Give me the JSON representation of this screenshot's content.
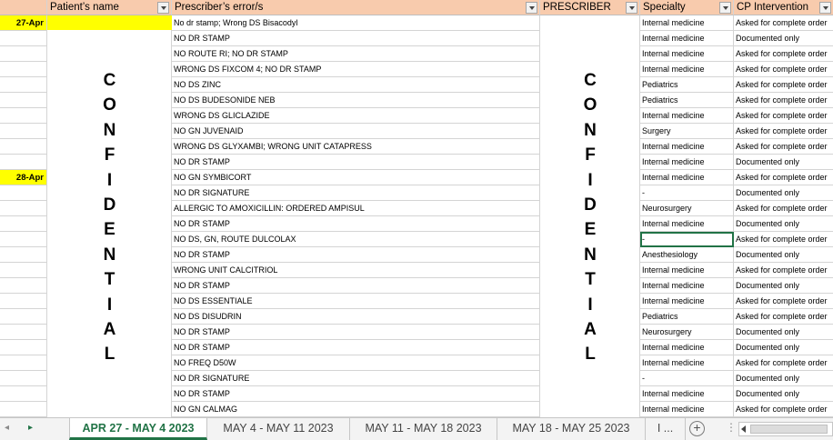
{
  "columns": {
    "patient": "Patient’s name",
    "error": "Prescriber’s error/s",
    "prescriber": "PRESCRIBER",
    "specialty": "Specialty",
    "intervention": "CP Intervention"
  },
  "confidential_letters": [
    "C",
    "O",
    "N",
    "F",
    "I",
    "D",
    "E",
    "N",
    "T",
    "I",
    "A",
    "L"
  ],
  "rows": [
    {
      "date": "27-Apr",
      "error": "No dr stamp; Wrong DS Bisacodyl",
      "specialty": "Internal medicine",
      "intervention": "Asked for complete order"
    },
    {
      "date": "",
      "error": "NO DR STAMP",
      "specialty": "Internal medicine",
      "intervention": "Documented only"
    },
    {
      "date": "",
      "error": "NO ROUTE RI; NO DR STAMP",
      "specialty": "Internal medicine",
      "intervention": "Asked for complete order"
    },
    {
      "date": "",
      "error": "WRONG DS FIXCOM 4; NO DR STAMP",
      "specialty": "Internal medicine",
      "intervention": "Asked for complete order"
    },
    {
      "date": "",
      "error": "NO DS ZINC",
      "specialty": "Pediatrics",
      "intervention": "Asked for complete order"
    },
    {
      "date": "",
      "error": "NO DS BUDESONIDE NEB",
      "specialty": "Pediatrics",
      "intervention": "Asked for complete order"
    },
    {
      "date": "",
      "error": "WRONG DS GLICLAZIDE",
      "specialty": "Internal medicine",
      "intervention": "Asked for complete order"
    },
    {
      "date": "",
      "error": "NO GN JUVENAID",
      "specialty": "Surgery",
      "intervention": "Asked for complete order"
    },
    {
      "date": "",
      "error": "WRONG DS GLYXAMBI; WRONG UNIT CATAPRESS",
      "specialty": "Internal medicine",
      "intervention": "Asked for complete order"
    },
    {
      "date": "",
      "error": "NO DR STAMP",
      "specialty": "Internal medicine",
      "intervention": "Documented only"
    },
    {
      "date": "28-Apr",
      "error": "NO GN SYMBICORT",
      "specialty": "Internal medicine",
      "intervention": "Asked for complete order"
    },
    {
      "date": "",
      "error": "NO DR SIGNATURE",
      "specialty": "-",
      "intervention": "Documented only"
    },
    {
      "date": "",
      "error": "ALLERGIC TO AMOXICILLIN: ORDERED AMPISUL",
      "specialty": "Neurosurgery",
      "intervention": "Asked for complete order"
    },
    {
      "date": "",
      "error": "NO DR STAMP",
      "specialty": "Internal medicine",
      "intervention": "Documented only"
    },
    {
      "date": "",
      "error": "NO DS, GN, ROUTE DULCOLAX",
      "specialty": "-",
      "intervention": "Asked for complete order"
    },
    {
      "date": "",
      "error": "NO DR STAMP",
      "specialty": "Anesthesiology",
      "intervention": "Documented only"
    },
    {
      "date": "",
      "error": "WRONG UNIT CALCITRIOL",
      "specialty": "Internal medicine",
      "intervention": "Asked for complete order"
    },
    {
      "date": "",
      "error": "NO DR STAMP",
      "specialty": "Internal medicine",
      "intervention": "Documented only"
    },
    {
      "date": "",
      "error": "NO DS ESSENTIALE",
      "specialty": "Internal medicine",
      "intervention": "Asked for complete order"
    },
    {
      "date": "",
      "error": "NO DS DISUDRIN",
      "specialty": "Pediatrics",
      "intervention": "Asked for complete order"
    },
    {
      "date": "",
      "error": "NO DR STAMP",
      "specialty": "Neurosurgery",
      "intervention": "Documented only"
    },
    {
      "date": "",
      "error": "NO DR STAMP",
      "specialty": "Internal medicine",
      "intervention": "Documented only"
    },
    {
      "date": "",
      "error": "NO FREQ D50W",
      "specialty": "Internal medicine",
      "intervention": "Asked for complete order"
    },
    {
      "date": "",
      "error": "NO DR SIGNATURE",
      "specialty": "-",
      "intervention": "Documented only"
    },
    {
      "date": "",
      "error": "NO DR STAMP",
      "specialty": "Internal medicine",
      "intervention": "Documented only"
    },
    {
      "date": "",
      "error": "NO GN CALMAG",
      "specialty": "Internal medicine",
      "intervention": "Asked for complete order"
    }
  ],
  "tabs": [
    {
      "label": "APR 27 - MAY 4 2023",
      "active": true
    },
    {
      "label": "MAY 4 - MAY 11 2023",
      "active": false
    },
    {
      "label": "MAY 11 - MAY 18 2023",
      "active": false
    },
    {
      "label": "MAY 18 - MAY 25 2023",
      "active": false
    }
  ],
  "tab_overflow": "I ...",
  "tab_nav": {
    "prev": "◂",
    "next": "▸"
  },
  "add_sheet": "+",
  "tab_separator": "⋮",
  "colors": {
    "header": "#f8cbad",
    "date_highlight": "#ffff00",
    "accent": "#217346"
  }
}
